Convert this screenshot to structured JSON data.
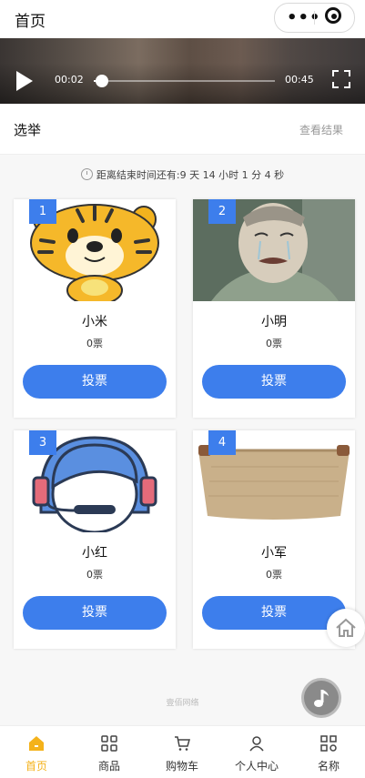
{
  "header": {
    "title": "首页"
  },
  "video": {
    "current_time": "00:02",
    "duration": "00:45",
    "progress": 0.044
  },
  "section": {
    "title": "选举",
    "link": "查看结果"
  },
  "countdown": {
    "text": "距离结束时间还有:9 天 14 小时 1 分 4 秒"
  },
  "candidates": [
    {
      "number": "1",
      "name": "小米",
      "votes": "0票",
      "button": "投票",
      "image": "tiger-cartoon"
    },
    {
      "number": "2",
      "name": "小明",
      "votes": "0票",
      "button": "投票",
      "image": "crying-man"
    },
    {
      "number": "3",
      "name": "小红",
      "votes": "0票",
      "button": "投票",
      "image": "headset-agent-icon"
    },
    {
      "number": "4",
      "name": "小军",
      "votes": "0票",
      "button": "投票",
      "image": "storage-basket"
    }
  ],
  "footer": {
    "text": "壹佰网络"
  },
  "tabbar": {
    "items": [
      {
        "label": "首页",
        "icon": "home-icon",
        "active": true
      },
      {
        "label": "商品",
        "icon": "grid-icon",
        "active": false
      },
      {
        "label": "购物车",
        "icon": "cart-icon",
        "active": false
      },
      {
        "label": "个人中心",
        "icon": "user-icon",
        "active": false
      },
      {
        "label": "名称",
        "icon": "apps-icon",
        "active": false
      }
    ]
  },
  "colors": {
    "accent": "#3d7eec",
    "tab_active": "#f4b21b"
  }
}
